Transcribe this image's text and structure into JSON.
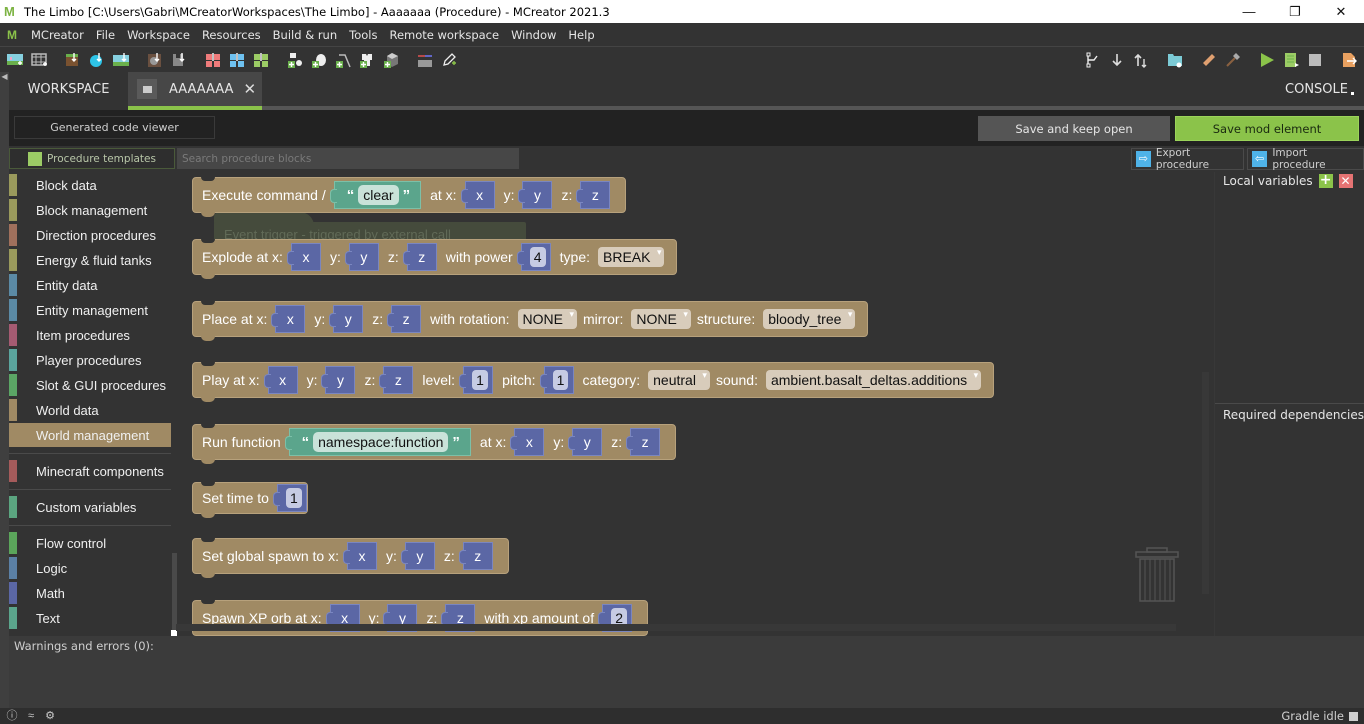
{
  "window": {
    "title": "The Limbo [C:\\Users\\Gabri\\MCreatorWorkspaces\\The Limbo] - Aaaaaaa (Procedure) - MCreator 2021.3",
    "minimize": "—",
    "maximize": "❐",
    "close": "✕"
  },
  "menu": {
    "logo": "M",
    "items": [
      "MCreator",
      "File",
      "Workspace",
      "Resources",
      "Build & run",
      "Tools",
      "Remote workspace",
      "Window",
      "Help"
    ]
  },
  "toolbar": {
    "left_icons": [
      "create-image-icon",
      "create-animation-icon",
      "import-block-texture-icon",
      "import-item-texture-icon",
      "import-other-texture-icon",
      "import-sound-icon",
      "import-structure-icon",
      "import-model-java-icon",
      "import-model-json-icon",
      "import-model-obj-icon",
      "create-armor-icon",
      "create-item-icon",
      "create-tool-icon",
      "create-entity-icon",
      "create-block-icon",
      "variables-icon",
      "edit-code-icon"
    ],
    "right_icons": [
      "git-branch-icon",
      "git-pull-icon",
      "git-sync-icon",
      "workspace-folder-icon",
      "setup-workspace-icon",
      "build-icon",
      "run-client-icon",
      "run-server-icon",
      "stop-icon",
      "export-mod-icon"
    ]
  },
  "tabs": {
    "workspace": "WORKSPACE",
    "active": "AAAAAAA",
    "close": "✕",
    "console": "CONSOLE"
  },
  "editor": {
    "code_viewer": "Generated code viewer",
    "save_keep_open": "Save and keep open",
    "save_mod_element": "Save mod element",
    "procedure_templates": "Procedure templates",
    "search_placeholder": "Search procedure blocks",
    "export": "Export procedure",
    "import": "Import procedure"
  },
  "palette": {
    "categories": [
      {
        "label": "Block data",
        "color": "#9a9a5c"
      },
      {
        "label": "Block management",
        "color": "#9a9a5c"
      },
      {
        "label": "Direction procedures",
        "color": "#a0705c"
      },
      {
        "label": "Energy & fluid tanks",
        "color": "#9a9a5c"
      },
      {
        "label": "Entity data",
        "color": "#5b8aa5"
      },
      {
        "label": "Entity management",
        "color": "#5b8aa5"
      },
      {
        "label": "Item procedures",
        "color": "#a55b72"
      },
      {
        "label": "Player procedures",
        "color": "#5ba59e"
      },
      {
        "label": "Slot & GUI procedures",
        "color": "#5ba565"
      },
      {
        "label": "World data",
        "color": "#a08a64"
      },
      {
        "label": "World management",
        "color": "#a08a64",
        "selected": true
      }
    ],
    "group2": [
      {
        "label": "Minecraft components",
        "color": "#a55b5b"
      }
    ],
    "group3": [
      {
        "label": "Custom variables",
        "color": "#5ba580"
      }
    ],
    "group4": [
      {
        "label": "Flow control",
        "color": "#5ba55b"
      },
      {
        "label": "Logic",
        "color": "#5b80a5"
      },
      {
        "label": "Math",
        "color": "#5b67a5"
      },
      {
        "label": "Text",
        "color": "#5ba58c"
      }
    ]
  },
  "blocks": {
    "execute_command": {
      "label": "Execute command /",
      "text": "clear",
      "at_x": "at x:",
      "x": "x",
      "y_lbl": "y:",
      "y": "y",
      "z_lbl": "z:",
      "z": "z"
    },
    "ghost": "Event trigger - triggered by external call",
    "explode": {
      "label": "Explode at x:",
      "x": "x",
      "y_lbl": "y:",
      "y": "y",
      "z_lbl": "z:",
      "z": "z",
      "power_lbl": "with power",
      "power": "4",
      "type_lbl": "type:",
      "type": "BREAK"
    },
    "place": {
      "label": "Place at x:",
      "x": "x",
      "y_lbl": "y:",
      "y": "y",
      "z_lbl": "z:",
      "z": "z",
      "rotation_lbl": "with rotation:",
      "rotation": "NONE",
      "mirror_lbl": "mirror:",
      "mirror": "NONE",
      "structure_lbl": "structure:",
      "structure": "bloody_tree"
    },
    "play": {
      "label": "Play at x:",
      "x": "x",
      "y_lbl": "y:",
      "y": "y",
      "z_lbl": "z:",
      "z": "z",
      "level_lbl": "level:",
      "level": "1",
      "pitch_lbl": "pitch:",
      "pitch": "1",
      "category_lbl": "category:",
      "category": "neutral",
      "sound_lbl": "sound:",
      "sound": "ambient.basalt_deltas.additions"
    },
    "run_function": {
      "label": "Run function",
      "text": "namespace:function",
      "at_x": "at x:",
      "x": "x",
      "y_lbl": "y:",
      "y": "y",
      "z_lbl": "z:",
      "z": "z"
    },
    "set_time": {
      "label": "Set time to",
      "value": "1"
    },
    "set_spawn": {
      "label": "Set global spawn to x:",
      "x": "x",
      "y_lbl": "y:",
      "y": "y",
      "z_lbl": "z:",
      "z": "z"
    },
    "spawn_xp": {
      "label": "Spawn XP orb at x:",
      "x": "x",
      "y_lbl": "y:",
      "y": "y",
      "z_lbl": "z:",
      "z": "z",
      "amount_lbl": "with xp amount of",
      "amount": "2"
    }
  },
  "side": {
    "local_variables": "Local variables",
    "required_dependencies": "Required dependencies"
  },
  "warnings": "Warnings and errors (0):",
  "status": {
    "gradle": "Gradle idle"
  }
}
